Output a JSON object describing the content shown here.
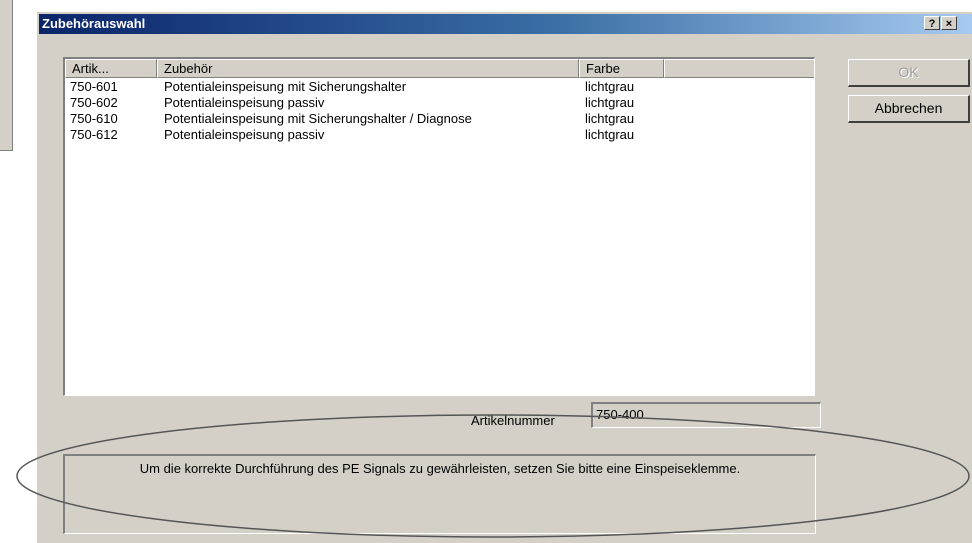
{
  "dialog": {
    "title": "Zubehörauswahl",
    "help_label": "?",
    "close_label": "×"
  },
  "list": {
    "columns": [
      "Artik...",
      "Zubehör",
      "Farbe",
      ""
    ],
    "rows": [
      {
        "artikel": "750-601",
        "zubehoer": "Potentialeinspeisung mit Sicherungshalter",
        "farbe": "lichtgrau"
      },
      {
        "artikel": "750-602",
        "zubehoer": "Potentialeinspeisung passiv",
        "farbe": "lichtgrau"
      },
      {
        "artikel": "750-610",
        "zubehoer": "Potentialeinspeisung mit Sicherungshalter / Diagnose",
        "farbe": "lichtgrau"
      },
      {
        "artikel": "750-612",
        "zubehoer": "Potentialeinspeisung passiv",
        "farbe": "lichtgrau"
      }
    ]
  },
  "buttons": {
    "ok": "OK",
    "cancel": "Abbrechen"
  },
  "artikelnummer": {
    "label": "Artikelnummer",
    "value": "750-400"
  },
  "message": "Um die korrekte Durchführung des PE Signals zu gewährleisten, setzen Sie bitte eine Einspeiseklemme.",
  "colors": {
    "dialog_bg": "#d4d0c8",
    "titlebar_start": "#0a246a",
    "titlebar_end": "#a6caf0",
    "annotation": "#555555"
  }
}
